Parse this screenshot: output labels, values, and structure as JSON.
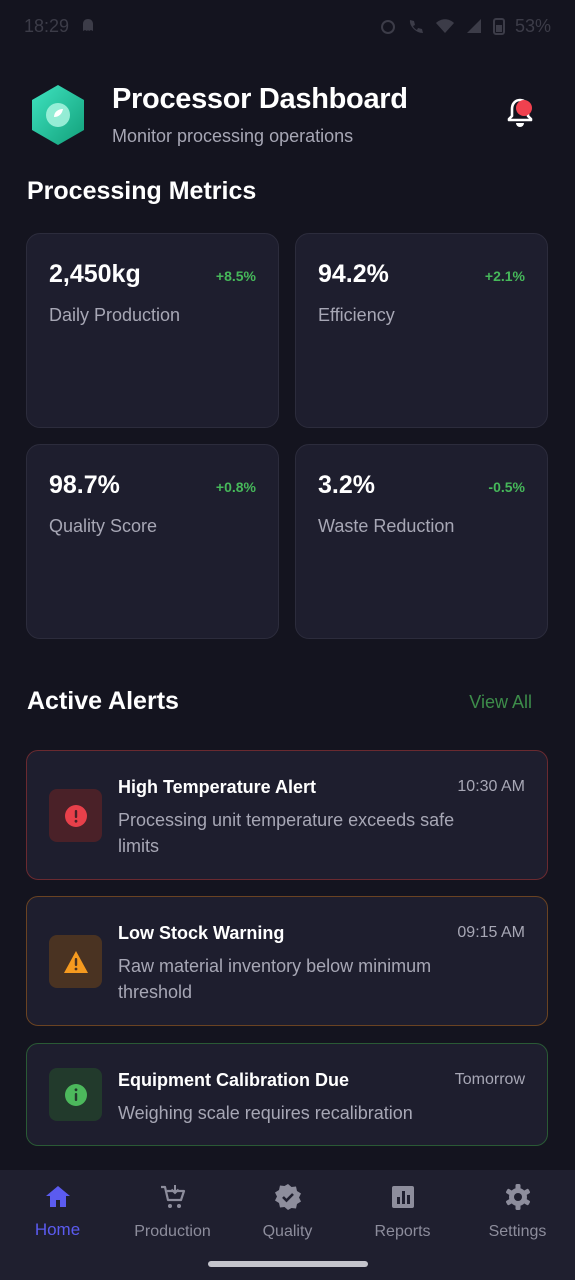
{
  "status_bar": {
    "time": "18:29",
    "battery": "53%"
  },
  "header": {
    "title": "Processor Dashboard",
    "subtitle": "Monitor processing operations"
  },
  "metrics": {
    "title": "Processing Metrics",
    "items": [
      {
        "value": "2,450kg",
        "change": "+8.5%",
        "label": "Daily Production"
      },
      {
        "value": "94.2%",
        "change": "+2.1%",
        "label": "Efficiency"
      },
      {
        "value": "98.7%",
        "change": "+0.8%",
        "label": "Quality Score"
      },
      {
        "value": "3.2%",
        "change": "-0.5%",
        "label": "Waste Reduction"
      }
    ]
  },
  "alerts": {
    "title": "Active Alerts",
    "view_all": "View All",
    "items": [
      {
        "title": "High Temperature Alert",
        "time": "10:30 AM",
        "description": "Processing unit temperature exceeds safe limits",
        "icon": "error-icon"
      },
      {
        "title": "Low Stock Warning",
        "time": "09:15 AM",
        "description": "Raw material inventory below minimum threshold",
        "icon": "warning-icon"
      },
      {
        "title": "Equipment Calibration Due",
        "time": "Tomorrow",
        "description": "Weighing scale requires recalibration",
        "icon": "info-icon"
      }
    ]
  },
  "nav": {
    "items": [
      {
        "label": "Home",
        "icon": "home-icon"
      },
      {
        "label": "Production",
        "icon": "production-cart-icon"
      },
      {
        "label": "Quality",
        "icon": "verified-badge-icon"
      },
      {
        "label": "Reports",
        "icon": "bar-chart-icon"
      },
      {
        "label": "Settings",
        "icon": "gear-icon"
      }
    ]
  },
  "colors": {
    "background": "#14141f",
    "card": "#1e1e2e",
    "positive": "#46b85a",
    "accent": "#5b5bf0",
    "danger": "#e8404a",
    "warning": "#f59a1f",
    "success": "#4cb85c"
  }
}
